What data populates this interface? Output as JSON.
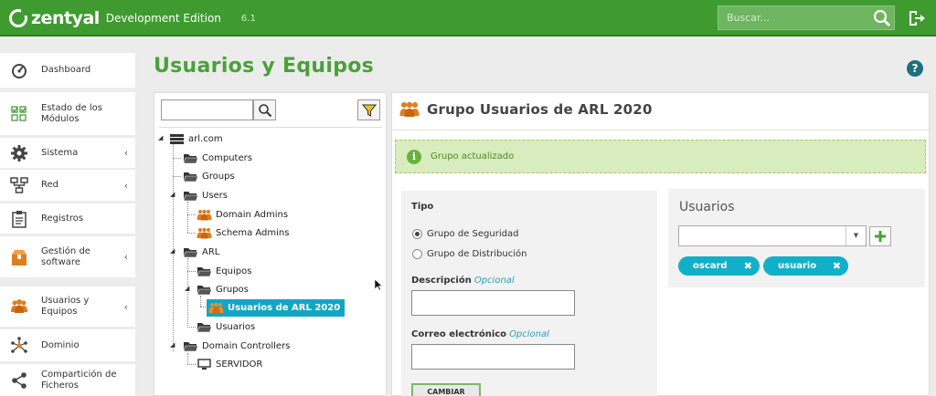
{
  "app": {
    "brand": "zentyal",
    "edition": "Development Edition",
    "version": "6.1"
  },
  "search": {
    "placeholder": "Buscar..."
  },
  "sidebar": {
    "items": [
      {
        "label": "Dashboard",
        "icon": "dashboard-icon",
        "chevron": false
      },
      {
        "label": "Estado de los Módulos",
        "icon": "modules-status-icon",
        "chevron": false
      },
      {
        "label": "Sistema",
        "icon": "gear-icon",
        "chevron": true
      },
      {
        "label": "Red",
        "icon": "network-icon",
        "chevron": true
      },
      {
        "label": "Registros",
        "icon": "clipboard-icon",
        "chevron": false
      },
      {
        "label": "Gestión de software",
        "icon": "package-icon",
        "chevron": true
      },
      {
        "label": "Usuarios y Equipos",
        "icon": "users-icon",
        "chevron": true
      },
      {
        "label": "Dominio",
        "icon": "domain-icon",
        "chevron": false
      },
      {
        "label": "Compartición de Ficheros",
        "icon": "file-share-icon",
        "chevron": false
      }
    ],
    "chevron_glyph": "‹"
  },
  "page": {
    "title": "Usuarios y Equipos",
    "help": "?"
  },
  "tree": {
    "nodes": [
      {
        "label": "arl.com",
        "icon": "domain-root-icon"
      },
      {
        "label": "Computers",
        "icon": "folder-icon"
      },
      {
        "label": "Groups",
        "icon": "folder-icon"
      },
      {
        "label": "Users",
        "icon": "folder-icon"
      },
      {
        "label": "Domain Admins",
        "icon": "group-icon"
      },
      {
        "label": "Schema Admins",
        "icon": "group-icon"
      },
      {
        "label": "ARL",
        "icon": "folder-icon"
      },
      {
        "label": "Equipos",
        "icon": "folder-icon"
      },
      {
        "label": "Grupos",
        "icon": "folder-icon"
      },
      {
        "label": "Usuarios de ARL 2020",
        "icon": "group-icon"
      },
      {
        "label": "Usuarios",
        "icon": "folder-icon"
      },
      {
        "label": "Domain Controllers",
        "icon": "folder-icon"
      },
      {
        "label": "SERVIDOR",
        "icon": "computer-icon"
      }
    ]
  },
  "group": {
    "title": "Grupo Usuarios de ARL 2020",
    "notice": "Grupo actualizado",
    "notice_icon": "i",
    "type_label": "Tipo",
    "radio_security": "Grupo de Seguridad",
    "radio_distribution": "Grupo de Distribución",
    "selected_type": "security",
    "description_label": "Descripción",
    "optional": "Opcional",
    "email_label": "Correo electrónico",
    "submit_label": "CAMBIAR"
  },
  "members": {
    "title": "Usuarios",
    "chips": [
      "oscard",
      "usuario"
    ],
    "remove_glyph": "✖",
    "dropdown_glyph": "▼"
  },
  "colors": {
    "topbar": "#3f9b2f",
    "accent_green": "#4aa13a",
    "selected_node": "#12a6c5",
    "chip": "#12b0c8",
    "notice_bg": "#d9ecbd"
  }
}
